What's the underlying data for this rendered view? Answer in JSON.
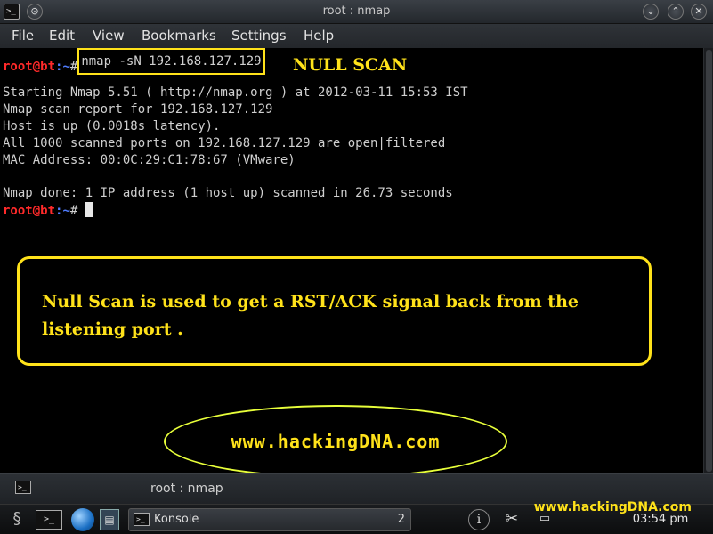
{
  "window": {
    "title": "root : nmap",
    "app_icon": ">_",
    "buttons": {
      "keep_above": "⊙",
      "minimize": "⌄",
      "maximize": "⌃",
      "close": "✕"
    }
  },
  "menu": [
    "File",
    "Edit",
    "View",
    "Bookmarks",
    "Settings",
    "Help"
  ],
  "terminal": {
    "prompt_user": "root@bt",
    "prompt_path": ":~",
    "prompt_symbol": "#",
    "command": "nmap -sN 192.168.127.129",
    "output": [
      "Starting Nmap 5.51 ( http://nmap.org ) at 2012-03-11 15:53 IST",
      "Nmap scan report for 192.168.127.129",
      "Host is up (0.0018s latency).",
      "All 1000 scanned ports on 192.168.127.129 are open|filtered",
      "MAC Address: 00:0C:29:C1:78:67 (VMware)",
      "",
      "Nmap done: 1 IP address (1 host up) scanned in 26.73 seconds"
    ]
  },
  "annotations": {
    "scan_label": "NULL SCAN",
    "note": "Null Scan is used to get a RST/ACK signal back from the listening port .",
    "site": "www.hackingDNA.com"
  },
  "tabbar": {
    "tab_label": "root : nmap",
    "tab_icon": ">_"
  },
  "taskbar": {
    "kde_icon": "§",
    "terminal_launcher": ">_",
    "file_launcher": "▤",
    "task_label": "Konsole",
    "task_icon": ">_",
    "task_count": "2",
    "info_icon": "i",
    "network_icon": "✂",
    "tray_icon": "▭",
    "watermark": "www.hackingDNA.com",
    "clock": "03:54 pm"
  },
  "colors": {
    "accent_yellow": "#ffe21a",
    "prompt_red": "#ff2a2a",
    "prompt_blue": "#4f7cff",
    "ellipse": "#e8ff3a"
  }
}
